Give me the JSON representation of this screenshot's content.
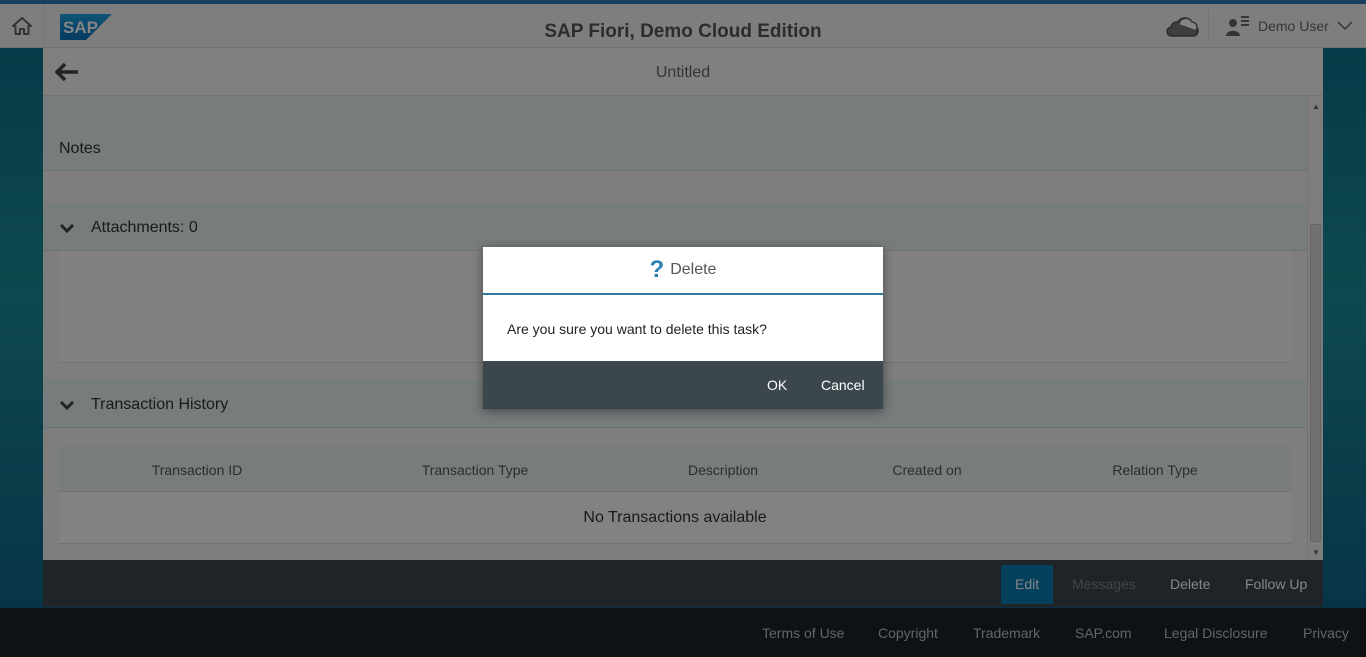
{
  "shell": {
    "title": "SAP Fiori, Demo Cloud Edition",
    "user": "Demo User",
    "logo_text": "SAP"
  },
  "app": {
    "title": "Untitled",
    "sections": {
      "notes": "Notes",
      "attachments": "Attachments: 0",
      "transactions": "Transaction History"
    },
    "table": {
      "columns": [
        "Transaction ID",
        "Transaction Type",
        "Description",
        "Created on",
        "Relation Type"
      ],
      "no_data": "No Transactions available"
    },
    "footer": {
      "edit": "Edit",
      "messages": "Messages",
      "delete": "Delete",
      "follow_up": "Follow Up"
    }
  },
  "legal_links": [
    "Terms of Use",
    "Copyright",
    "Trademark",
    "SAP.com",
    "Legal Disclosure",
    "Privacy"
  ],
  "dialog": {
    "icon": "?",
    "title": "Delete",
    "message": "Are you sure you want to delete this task?",
    "ok": "OK",
    "cancel": "Cancel"
  },
  "colors": {
    "accent": "#0a7cb0",
    "footer_bar": "#3c464d",
    "shell_bar": "#f2f2f2"
  }
}
